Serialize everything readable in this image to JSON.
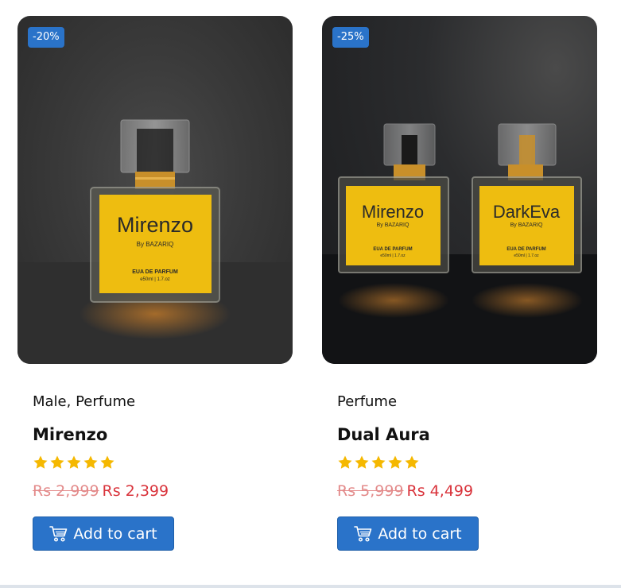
{
  "colors": {
    "accent": "#2a73c9",
    "price_new": "#d9333b",
    "price_old": "#e38a8a",
    "star": "#f5b800",
    "label_yellow": "#eebd10"
  },
  "products": [
    {
      "discount": "-20%",
      "categories": "Male, Perfume",
      "name": "Mirenzo",
      "rating": 5,
      "old_price": "Rs 2,999",
      "new_price": "Rs 2,399",
      "button_label": "Add to cart",
      "button_icon": "cart-icon",
      "bottles": [
        {
          "label": "Mirenzo",
          "brand": "By BAZARIQ",
          "type": "EUA DE PARFUM",
          "size": "e50ml | 1.7.oz"
        }
      ]
    },
    {
      "discount": "-25%",
      "categories": "Perfume",
      "name": "Dual Aura",
      "rating": 5,
      "old_price": "Rs 5,999",
      "new_price": "Rs 4,499",
      "button_label": "Add to cart",
      "button_icon": "cart-icon",
      "bottles": [
        {
          "label": "Mirenzo",
          "brand": "By BAZARIQ",
          "type": "EUA DE PARFUM",
          "size": "e50ml | 1.7.oz"
        },
        {
          "label": "DarkEva",
          "brand": "By BAZARIQ",
          "type": "EUA DE PARFUM",
          "size": "e50ml | 1.7.oz"
        }
      ]
    }
  ]
}
